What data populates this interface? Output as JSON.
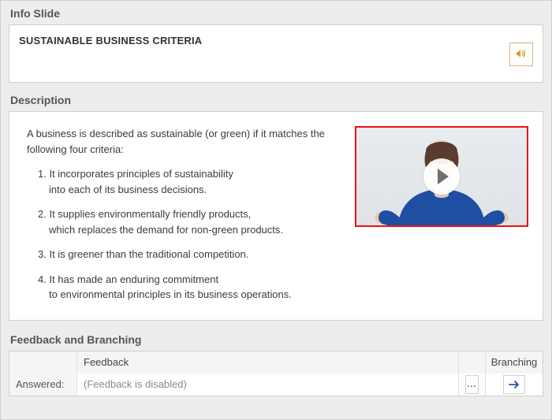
{
  "sections": {
    "info_title": "Info Slide",
    "description_title": "Description",
    "fb_title": "Feedback and Branching"
  },
  "info_slide": {
    "title": "SUSTAINABLE BUSINESS CRITERIA"
  },
  "description": {
    "intro": "A business is described as sustainable (or green) if it matches the following four criteria:",
    "criteria": [
      {
        "n": "1.",
        "l1": "It incorporates principles of sustainability",
        "l2": "into each of its business decisions."
      },
      {
        "n": "2.",
        "l1": "It supplies environmentally friendly products,",
        "l2": "which replaces the demand for non-green products."
      },
      {
        "n": "3.",
        "l1": "It is greener than the traditional competition.",
        "l2": ""
      },
      {
        "n": "4.",
        "l1": "It has made an enduring commitment",
        "l2": "to environmental principles in its business operations."
      }
    ]
  },
  "feedback": {
    "header_feedback": "Feedback",
    "header_branching": "Branching",
    "row_label": "Answered:",
    "row_value": "(Feedback is disabled)",
    "more_label": "..."
  }
}
